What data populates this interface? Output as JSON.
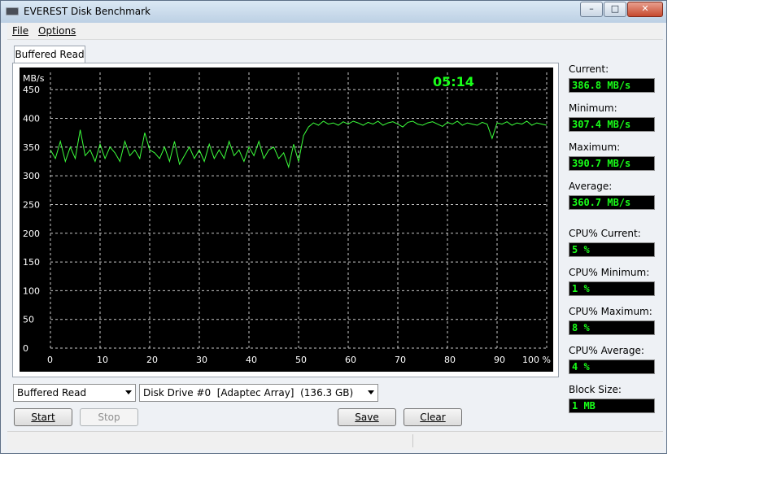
{
  "window": {
    "title": "EVEREST Disk Benchmark",
    "min_glyph": "–",
    "max_glyph": "□",
    "close_glyph": "✕"
  },
  "menu": {
    "file": "File",
    "options": "Options"
  },
  "tab": {
    "label": "Buffered Read"
  },
  "chart_data": {
    "type": "line",
    "title": "",
    "timer": "05:14",
    "ylabel": "MB/s",
    "xlabel_unit": "%",
    "ylim": [
      0,
      480
    ],
    "xlim": [
      0,
      100
    ],
    "y_ticks": [
      "0",
      "50",
      "100",
      "150",
      "200",
      "250",
      "300",
      "350",
      "400",
      "450"
    ],
    "x_ticks": [
      "0",
      "10",
      "20",
      "30",
      "40",
      "50",
      "60",
      "70",
      "80",
      "90",
      "100 %"
    ],
    "grid": true,
    "line_color": "#3cff3c",
    "series": [
      {
        "x": [
          0,
          1,
          2,
          3,
          4,
          5,
          6,
          7,
          8,
          9,
          10,
          11,
          12,
          13,
          14,
          15,
          16,
          17,
          18,
          19,
          20,
          21,
          22,
          23,
          24,
          25,
          26,
          27,
          28,
          29,
          30,
          31,
          32,
          33,
          34,
          35,
          36,
          37,
          38,
          39,
          40,
          41,
          42,
          43,
          44,
          45,
          46,
          47,
          48,
          49,
          50,
          51,
          52,
          53,
          54,
          55,
          56,
          57,
          58,
          59,
          60,
          61,
          62,
          63,
          64,
          65,
          66,
          67,
          68,
          69,
          70,
          71,
          72,
          73,
          74,
          75,
          76,
          77,
          78,
          79,
          80,
          81,
          82,
          83,
          84,
          85,
          86,
          87,
          88,
          89,
          90,
          91,
          92,
          93,
          94,
          95,
          96,
          97,
          98,
          99,
          100
        ],
        "y": [
          345,
          330,
          360,
          325,
          350,
          330,
          380,
          335,
          345,
          325,
          355,
          330,
          350,
          340,
          325,
          360,
          335,
          345,
          330,
          375,
          345,
          340,
          330,
          350,
          325,
          360,
          320,
          335,
          350,
          330,
          345,
          325,
          355,
          330,
          345,
          330,
          360,
          335,
          345,
          325,
          350,
          335,
          360,
          330,
          345,
          350,
          330,
          340,
          315,
          355,
          325,
          370,
          385,
          392,
          388,
          395,
          390,
          392,
          388,
          394,
          390,
          395,
          392,
          388,
          393,
          390,
          395,
          388,
          392,
          394,
          390,
          385,
          393,
          395,
          390,
          388,
          392,
          394,
          390,
          386,
          393,
          390,
          395,
          388,
          392,
          390,
          388,
          393,
          390,
          365,
          392,
          390,
          394,
          388,
          392,
          390,
          395,
          388,
          392,
          390,
          388
        ]
      }
    ]
  },
  "stats": {
    "current_label": "Current:",
    "current_value": "386.8 MB/s",
    "minimum_label": "Minimum:",
    "minimum_value": "307.4 MB/s",
    "maximum_label": "Maximum:",
    "maximum_value": "390.7 MB/s",
    "average_label": "Average:",
    "average_value": "360.7 MB/s",
    "cpu_current_label": "CPU% Current:",
    "cpu_current_value": "5 %",
    "cpu_minimum_label": "CPU% Minimum:",
    "cpu_minimum_value": "1 %",
    "cpu_maximum_label": "CPU% Maximum:",
    "cpu_maximum_value": "8 %",
    "cpu_average_label": "CPU% Average:",
    "cpu_average_value": "4 %",
    "block_size_label": "Block Size:",
    "block_size_value": "1 MB"
  },
  "controls": {
    "mode_select": "Buffered Read",
    "drive_select": "Disk Drive #0  [Adaptec Array]  (136.3 GB)",
    "start": "Start",
    "stop": "Stop",
    "save": "Save",
    "clear": "Clear"
  }
}
